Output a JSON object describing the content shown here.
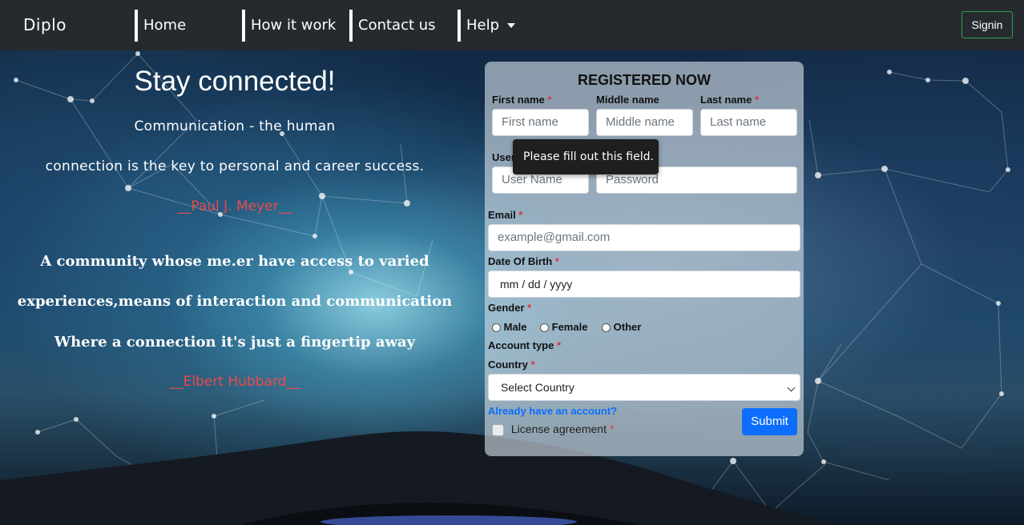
{
  "navbar": {
    "brand": "Diplo",
    "items": [
      {
        "label": "Home"
      },
      {
        "label": "How it work"
      },
      {
        "label": "Contact us"
      },
      {
        "label": "Help"
      }
    ],
    "signin_label": "Signin"
  },
  "hero": {
    "headline": "Stay connected!",
    "quote1_line1": "Communication - the human",
    "quote1_line2": "connection is the key to personal and career success.",
    "quote1_author": "__Paul J. Meyer__",
    "quote2_line1": "A community whose me.er have access to varied",
    "quote2_line2": "experiences,means of interaction and communication",
    "quote2_line3": "Where a connection it's just a fingertip away",
    "quote2_author": "__Elbert Hubbard__"
  },
  "form": {
    "title": "REGISTERED NOW",
    "first_name": {
      "label": "First name",
      "placeholder": "First name"
    },
    "middle_name": {
      "label": "Middle name",
      "placeholder": "Middle name"
    },
    "last_name": {
      "label": "Last name",
      "placeholder": "Last name"
    },
    "username": {
      "label": "User",
      "placeholder": "User Name"
    },
    "password": {
      "placeholder": "Password"
    },
    "email": {
      "label": "Email",
      "placeholder": "example@gmail.com"
    },
    "dob": {
      "label": "Date Of Birth",
      "value": "mm / dd / yyyy"
    },
    "gender": {
      "label": "Gender",
      "options": [
        "Male",
        "Female",
        "Other"
      ]
    },
    "account_type": {
      "label": "Account type"
    },
    "country": {
      "label": "Country",
      "selected": "Select Country"
    },
    "login_link": "Already have an account?",
    "license_label": "License agreement",
    "required_mark": "*",
    "submit_label": "Submit",
    "validation_tooltip": "Please fill out this field."
  },
  "colors": {
    "navbar": "#262a2e",
    "signin_border": "#2fa24a",
    "required": "#dc3545",
    "author": "#e84b4b",
    "accent": "#0d6efd"
  }
}
